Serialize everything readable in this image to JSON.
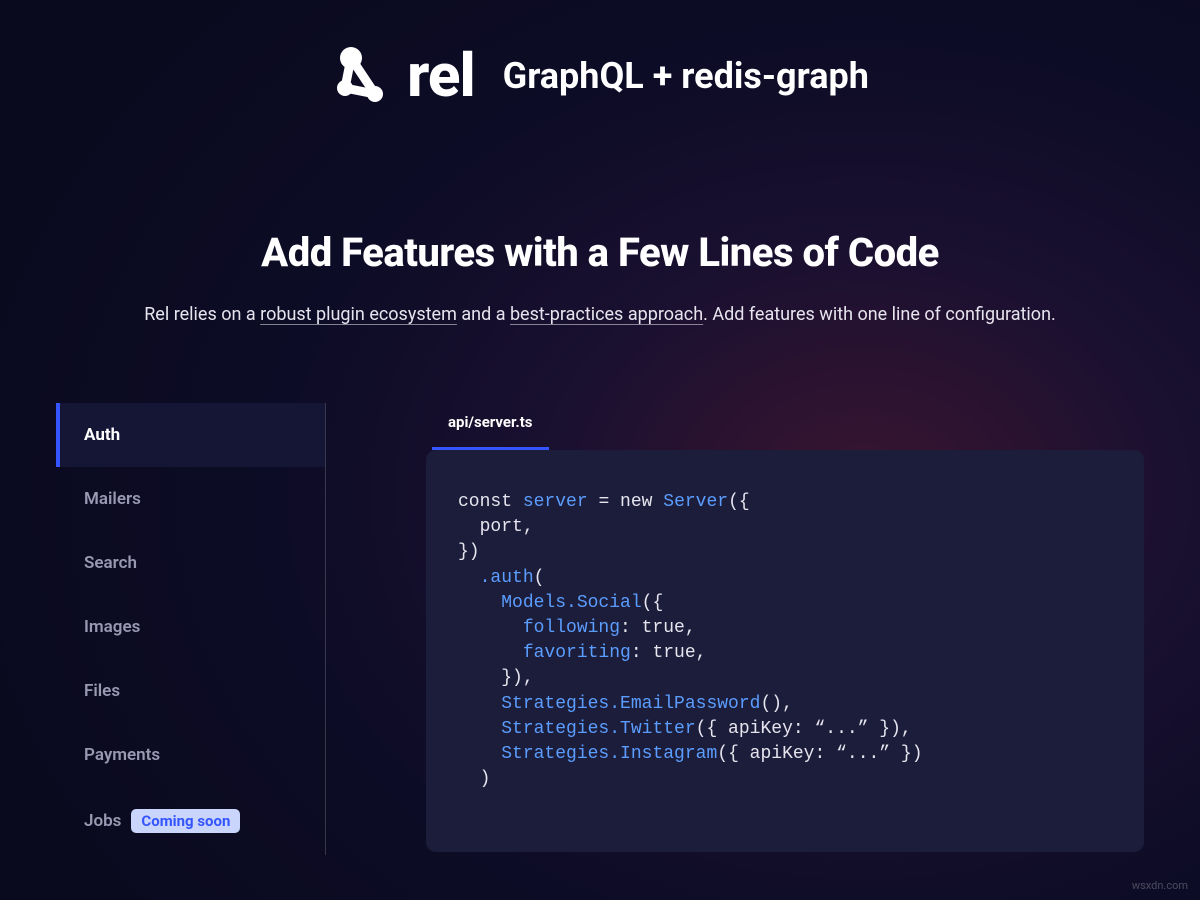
{
  "brand": {
    "name": "rel",
    "tagline": "GraphQL + redis-graph"
  },
  "hero": {
    "title": "Add Features with a Few Lines of Code",
    "sub_prefix": "Rel relies on a ",
    "sub_link1": "robust plugin ecosystem",
    "sub_mid": " and a ",
    "sub_link2": "best-practices approach",
    "sub_suffix": ". Add features with one line of configuration."
  },
  "sidebar": {
    "items": [
      {
        "label": "Auth",
        "active": true
      },
      {
        "label": "Mailers"
      },
      {
        "label": "Search"
      },
      {
        "label": "Images"
      },
      {
        "label": "Files"
      },
      {
        "label": "Payments"
      },
      {
        "label": "Jobs",
        "badge": "Coming soon"
      }
    ]
  },
  "code": {
    "file": "api/server.ts",
    "tokens": {
      "kw_const": "const",
      "var_server": "server",
      "eq_new": " = new ",
      "cls_server": "Server",
      "open1": "({",
      "port_line": "port,",
      "close1": "})",
      "dot_auth": ".auth",
      "open2": "(",
      "models_social": "Models.Social",
      "open3": "({",
      "following": "following",
      "following_val": ": true,",
      "favoriting": "favoriting",
      "favoriting_val": ": true,",
      "close3": "}),",
      "strat_ep": "Strategies.EmailPassword",
      "ep_tail": "(),",
      "strat_tw": "Strategies.Twitter",
      "tw_tail": "({ apiKey: “...” }),",
      "strat_ig": "Strategies.Instagram",
      "ig_tail": "({ apiKey: “...” })",
      "close2": ")"
    }
  },
  "attribution": "wsxdn.com"
}
